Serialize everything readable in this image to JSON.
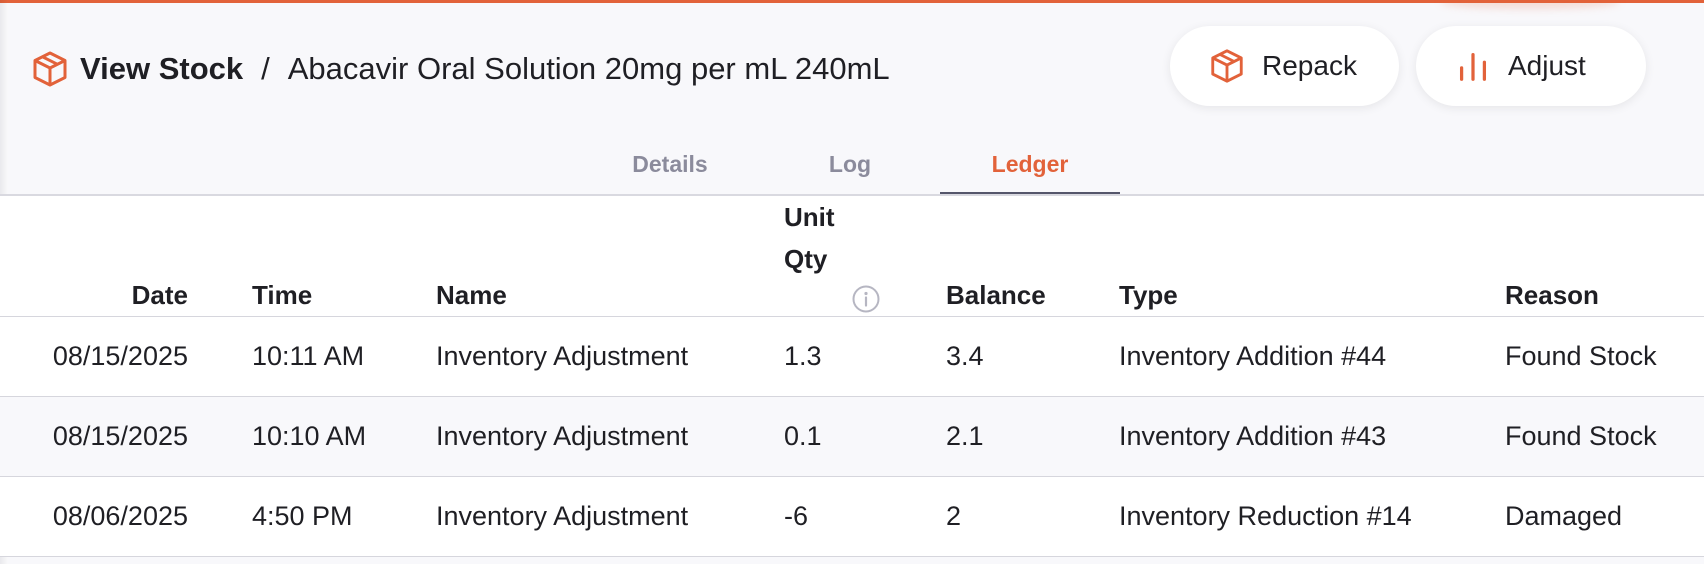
{
  "header": {
    "section_title": "View Stock",
    "separator": "/",
    "item_title": "Abacavir Oral Solution 20mg per mL 240mL",
    "repack_label": "Repack",
    "adjust_label": "Adjust"
  },
  "tabs": [
    {
      "label": "Details",
      "active": false
    },
    {
      "label": "Log",
      "active": false
    },
    {
      "label": "Ledger",
      "active": true
    }
  ],
  "table": {
    "headers": {
      "date": "Date",
      "time": "Time",
      "name": "Name",
      "unit_qty_line1": "Unit",
      "unit_qty_line2": "Qty",
      "balance": "Balance",
      "type": "Type",
      "reason": "Reason"
    },
    "rows": [
      {
        "date": "08/15/2025",
        "time": "10:11 AM",
        "name": "Inventory Adjustment",
        "unit_qty": "1.3",
        "balance": "3.4",
        "type": "Inventory Addition #44",
        "reason": "Found Stock"
      },
      {
        "date": "08/15/2025",
        "time": "10:10 AM",
        "name": "Inventory Adjustment",
        "unit_qty": "0.1",
        "balance": "2.1",
        "type": "Inventory Addition #43",
        "reason": "Found Stock"
      },
      {
        "date": "08/06/2025",
        "time": "4:50 PM",
        "name": "Inventory Adjustment",
        "unit_qty": "-6",
        "balance": "2",
        "type": "Inventory Reduction #14",
        "reason": "Damaged"
      }
    ]
  },
  "icons": {
    "title": "package-icon",
    "repack": "package-icon",
    "adjust": "bar-chart-icon",
    "unit_qty_info": "info-icon"
  },
  "colors": {
    "accent": "#e2623a",
    "tab_inactive": "#8b8b9c",
    "tab_underline": "#55566b",
    "text": "#1f1f24",
    "background": "#f8f8fb"
  }
}
